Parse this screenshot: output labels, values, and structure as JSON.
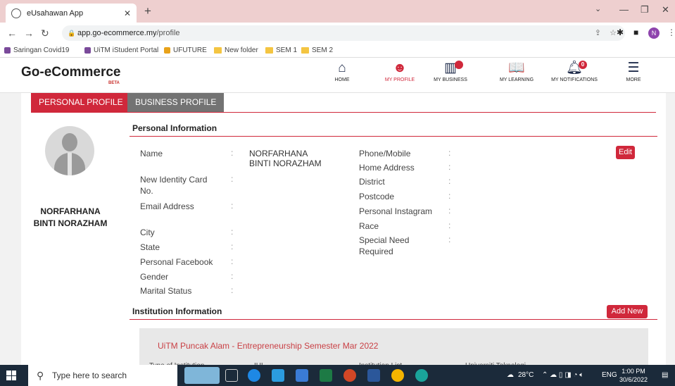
{
  "browser": {
    "tab_title": "eUsahawan App",
    "url_host": "app.go-ecommerce.my",
    "url_path": "/profile",
    "bookmarks": [
      {
        "label": "Saringan Covid19"
      },
      {
        "label": "UiTM iStudent Portal"
      },
      {
        "label": "UFUTURE"
      },
      {
        "label": "New folder"
      },
      {
        "label": "SEM 1"
      },
      {
        "label": "SEM 2"
      }
    ],
    "profile_initial": "N"
  },
  "header": {
    "logo": "Go-eCommerce",
    "beta": "BETA",
    "menu": [
      {
        "label": "HOME",
        "icon": "home-icon"
      },
      {
        "label": "MY PROFILE",
        "icon": "user-icon"
      },
      {
        "label": "MY BUSINESS",
        "icon": "chart-icon"
      },
      {
        "label": "MY LEARNING",
        "icon": "book-icon"
      },
      {
        "label": "MY NOTIFICATIONS",
        "icon": "bell-icon",
        "badge": "0"
      },
      {
        "label": "MORE",
        "icon": "hamburger-icon"
      }
    ]
  },
  "tabs": {
    "personal": "PERSONAL PROFILE",
    "business": "BUSINESS PROFILE"
  },
  "user": {
    "name": "NORFARHANA BINTI NORAZHAM"
  },
  "personal_info": {
    "title": "Personal Information",
    "edit_label": "Edit",
    "name_label": "Name",
    "name_value": "NORFARHANA BINTI NORAZHAM",
    "ic_label": "New Identity Card No.",
    "email_label": "Email Address",
    "city_label": "City",
    "state_label": "State",
    "facebook_label": "Personal Facebook",
    "gender_label": "Gender",
    "marital_label": "Marital Status",
    "phone_label": "Phone/Mobile",
    "address_label": "Home Address",
    "district_label": "District",
    "postcode_label": "Postcode",
    "instagram_label": "Personal Instagram",
    "race_label": "Race",
    "special_label": "Special Need Required",
    "colon": ":"
  },
  "institution": {
    "title": "Institution Information",
    "add_label": "Add New",
    "entry_title": "UiTM Puncak Alam - Entrepreneurship Semester Mar 2022",
    "cut_labels": [
      "Type of Institution",
      "IHL",
      "Institution List",
      "Universiti Teknologi"
    ]
  },
  "taskbar": {
    "search_placeholder": "Type here to search",
    "temperature": "28°C",
    "language": "ENG",
    "time": "1:00 PM",
    "date": "30/6/2022"
  }
}
